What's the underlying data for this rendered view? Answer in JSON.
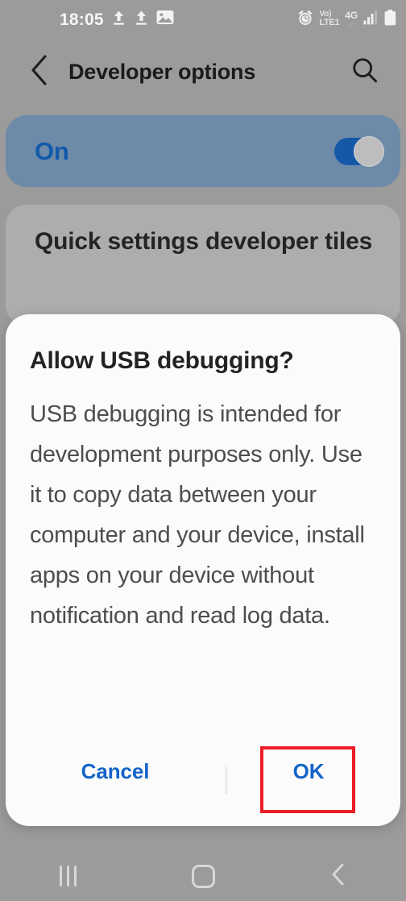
{
  "status_bar": {
    "clock": "18:05",
    "left_icons": [
      "upload-icon",
      "upload-icon",
      "image-icon"
    ],
    "volte": {
      "top": "Vo)",
      "bottom": "LTE1"
    },
    "network": {
      "type": "4G",
      "data_arrows": "↓↑"
    },
    "right_icons": [
      "alarm-icon",
      "signal-bars-icon",
      "battery-icon"
    ]
  },
  "header": {
    "back_icon": "chevron-left-icon",
    "title": "Developer options",
    "search_icon": "search-icon"
  },
  "settings": {
    "master_switch": {
      "label": "On",
      "state": "on"
    },
    "items": [
      {
        "label": "Quick settings developer tiles"
      }
    ]
  },
  "dialog": {
    "title": "Allow USB debugging?",
    "message": "USB debugging is intended for development purposes only. Use it to copy data between your computer and your device, install apps on your device without notification and read log data.",
    "cancel_label": "Cancel",
    "ok_label": "OK"
  },
  "annotation": {
    "target": "OK",
    "color": "#ee1c25"
  },
  "nav_bar": {
    "recents_icon": "recents-icon",
    "home_icon": "home-icon",
    "back_icon": "chevron-left-icon"
  },
  "colors": {
    "scrim_background": "#9b9b9b",
    "master_card": "#6d8aa8",
    "master_label": "#1159ab",
    "toggle_track": "#1458a8",
    "tiles_card": "#adadad",
    "dialog_background": "#fbfbfb",
    "button_text": "#1464c8",
    "highlight": "#ee1c25"
  }
}
